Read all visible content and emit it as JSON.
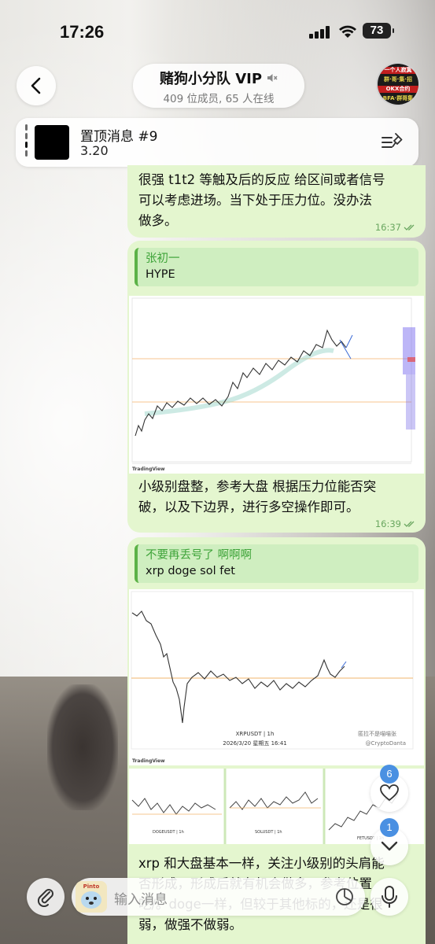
{
  "status_bar": {
    "time": "17:26",
    "battery": "73"
  },
  "header": {
    "title": "赌狗小分队 VIP",
    "subtitle": "409 位成员, 65 人在线",
    "avatar_lines": [
      "一个人寂寞",
      "群·哥·集·招",
      "OKX合约",
      "BFA·群哥集"
    ]
  },
  "pinned": {
    "title": "置顶消息 #9",
    "text": "3.20"
  },
  "messages": [
    {
      "text": "很强 t1t2 等触及后的反应 给区间或者信号\n可以考虑进场。当下处于压力位。没办法\n做多。",
      "time": "16:37"
    },
    {
      "reply_name": "张初一",
      "reply_text": "HYPE",
      "chart_footer": "TradingView",
      "text": "小级别盘整，参考大盘 根据压力位能否突\n破，以及下边界，进行多空操作即可。",
      "time": "16:39"
    },
    {
      "reply_name": "不要再丢号了 啊啊啊",
      "reply_text": "xrp doge sol fet",
      "chart_title": "XRPUSDT | 1h",
      "chart_date": "2026/3/20 星期五 16:41",
      "chart_watermark_1": "匿拉不是喵喵张",
      "chart_watermark_2": "@CryptoDanta",
      "chart_footer": "TradingView",
      "mini_labels": [
        "DOGEUSDT | 1h",
        "SOLUSDT | 1h",
        "FETUSDT | 1h"
      ],
      "text": "xrp 和大盘基本一样，关注小级别的头肩能\n否形成，形成后就有机会做多，参考位置\n吃/。doge一样，但较于其他标的，还是很\n弱，做强不做弱。"
    }
  ],
  "fabs": {
    "reactions_badge": "6",
    "scroll_badge": "1"
  },
  "input": {
    "placeholder": "输入消息",
    "sticker_label": "Pinto"
  },
  "colors": {
    "bubble": "#e4f6cf",
    "reply_accent": "#5cb247",
    "badge": "#4a90e2"
  }
}
